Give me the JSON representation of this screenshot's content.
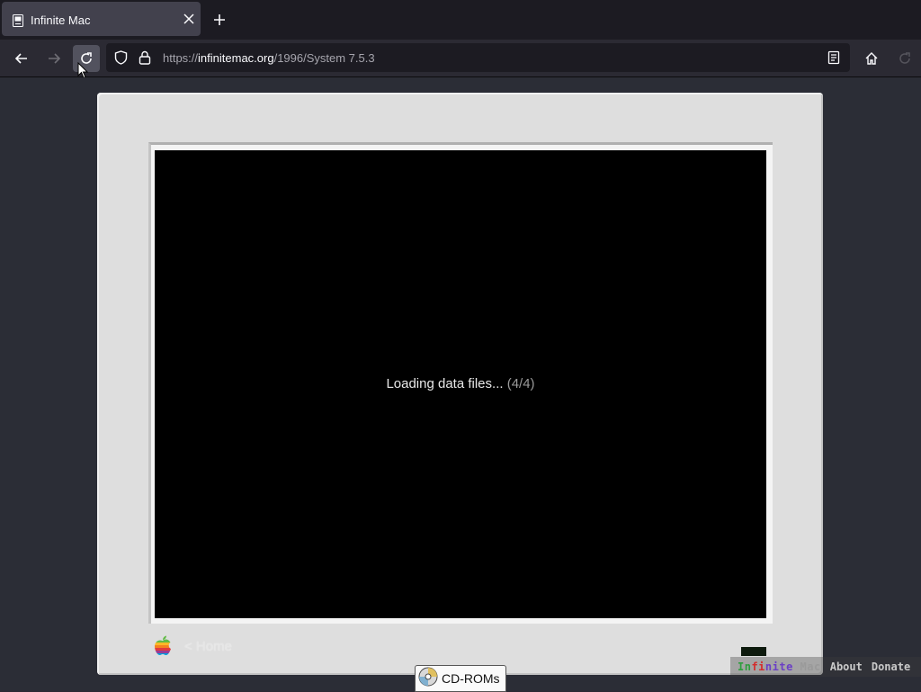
{
  "browser": {
    "tab": {
      "title": "Infinite Mac"
    },
    "url": {
      "scheme": "https://",
      "host": "infinitemac.org",
      "path": "/1996/System 7.5.3"
    }
  },
  "emulator": {
    "status_text": "Loading data files...",
    "progress_text": "(4/4)",
    "home_link": "< Home",
    "cdrom_button": "CD-ROMs"
  },
  "footer": {
    "brand": {
      "part1": "In",
      "part2": "fi",
      "part3": "nite",
      "part4": " Mac"
    },
    "about": "About",
    "donate": "Donate"
  },
  "colors": {
    "chrome_bg": "#1c1b22",
    "page_bg": "#2b2d36",
    "monitor_bezel": "#dedede",
    "screen": "#000000"
  },
  "icons": [
    "mac-favicon-icon",
    "close-icon",
    "plus-icon",
    "arrow-left-icon",
    "arrow-right-icon",
    "reload-icon",
    "shield-icon",
    "lock-icon",
    "reader-view-icon",
    "home-icon",
    "extension-icon",
    "apple-logo-icon",
    "cd-icon"
  ]
}
